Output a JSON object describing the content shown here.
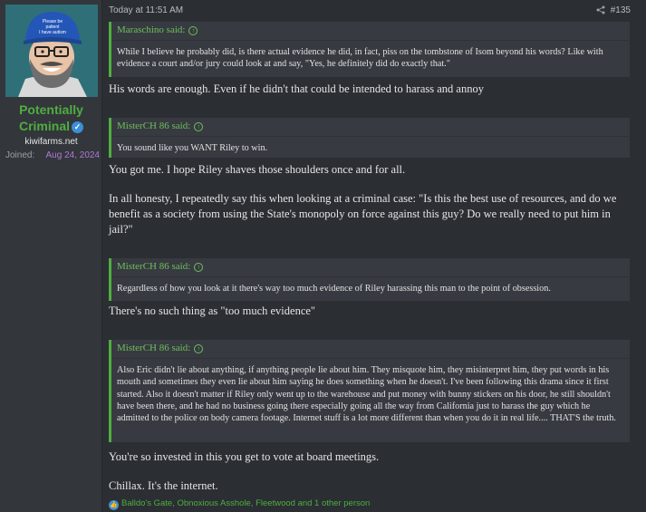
{
  "user": {
    "name_line1": "Potentially",
    "name_line2": "Criminal",
    "title": "kiwifarms.net",
    "joined_label": "Joined:",
    "joined_date": "Aug 24, 2024",
    "avatar_cap_text": [
      "Please be",
      "patient",
      "I have autism"
    ]
  },
  "post": {
    "time": "Today at 11:51 AM",
    "number": "#135",
    "quotes": [
      {
        "author": "Maraschino said:",
        "body": "While I believe he probably did, is there actual evidence he did, in fact, piss on the tombstone of Isom beyond his words? Like with evidence a court and/or jury could look at and say, \"Yes, he definitely did do exactly that.\""
      },
      {
        "author": "MisterCH 86 said:",
        "body": "You sound like you WANT Riley to win."
      },
      {
        "author": "MisterCH 86 said:",
        "body": "Regardless of how you look at it there's way too much evidence of Riley harassing this man to the point of obsession."
      },
      {
        "author": "MisterCH 86 said:",
        "body": "Also Eric didn't lie about anything, if anything people lie about him. They misquote him, they misinterpret him, they put words in his mouth and sometimes they even lie about him saying he does something when he doesn't. I've been following this drama since it first started. Also it doesn't matter if Riley only went up to the warehouse and put money with bunny stickers on his door, he still shouldn't have been there, and he had no business going there especially going all the way from California just to harass the guy which he admitted to the police on body camera footage. Internet stuff is a lot more different than when you do it in real life.... THAT'S the truth."
      }
    ],
    "replies": [
      "His words are enough. Even if he didn't that could be intended to harass and annoy",
      "You got me. I hope Riley shaves those shoulders once and for all.",
      "In all honesty, I repeatedly say this when looking at a criminal case: \"Is this the best use of resources, and do we benefit as a society from using the State's monopoly on force against this guy? Do we really need to put him in jail?\"",
      "There's no such thing as \"too much evidence\"",
      "You're so invested in this you get to vote at board meetings.",
      "Chillax. It's the internet."
    ],
    "reactions": "Balldo's Gate, Obnoxious Asshole, Fleetwood and 1 other person"
  },
  "colors": {
    "background": "#2b2e33",
    "sidebar": "#33363b",
    "accent_green": "#4fae3f",
    "quote_bg": "#373a40",
    "joined_date": "#b07ad6",
    "verified_blue": "#3b8fd8"
  },
  "icons": {
    "share": "share-icon",
    "verified": "verified-badge-icon",
    "quote_jump": "arrow-up-circle-icon",
    "like": "like-icon"
  }
}
